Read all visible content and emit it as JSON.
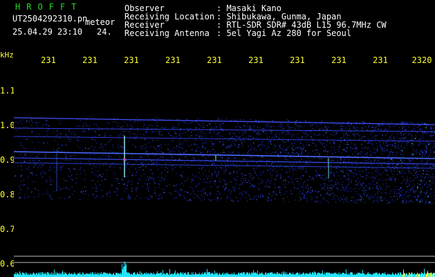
{
  "header": {
    "logo": "HROFFT",
    "filename": "UT2504292310.pn",
    "mode": "meteor",
    "datetime": "25.04.29 23:10",
    "count": "24.",
    "fields": [
      {
        "label": "Observer",
        "value": ": Masaki Kano"
      },
      {
        "label": "Receiving Location",
        "value": ": Shibukawa, Gunma, Japan"
      },
      {
        "label": "Receiver",
        "value": ": RTL-SDR SDR# 43dB L15 96.7MHz CW"
      },
      {
        "label": "Receiving Antenna",
        "value": ": 5el Yagi Az 280 for Seoul"
      }
    ]
  },
  "axes": {
    "y_unit": "kHz",
    "x_ticks": [
      "231",
      "231",
      "231",
      "231",
      "231",
      "231",
      "231",
      "231",
      "231",
      "2320"
    ],
    "y_ticks": [
      "1.1",
      "1.0",
      "0.9",
      "0.8",
      "0.7",
      "0.6"
    ]
  },
  "colors": {
    "background": "#000000",
    "text": "#ffffff",
    "logo": "#22dd22",
    "ticks": "#ffff33",
    "signal": "#3344ff",
    "noise_floor": "#22e5ff"
  }
}
